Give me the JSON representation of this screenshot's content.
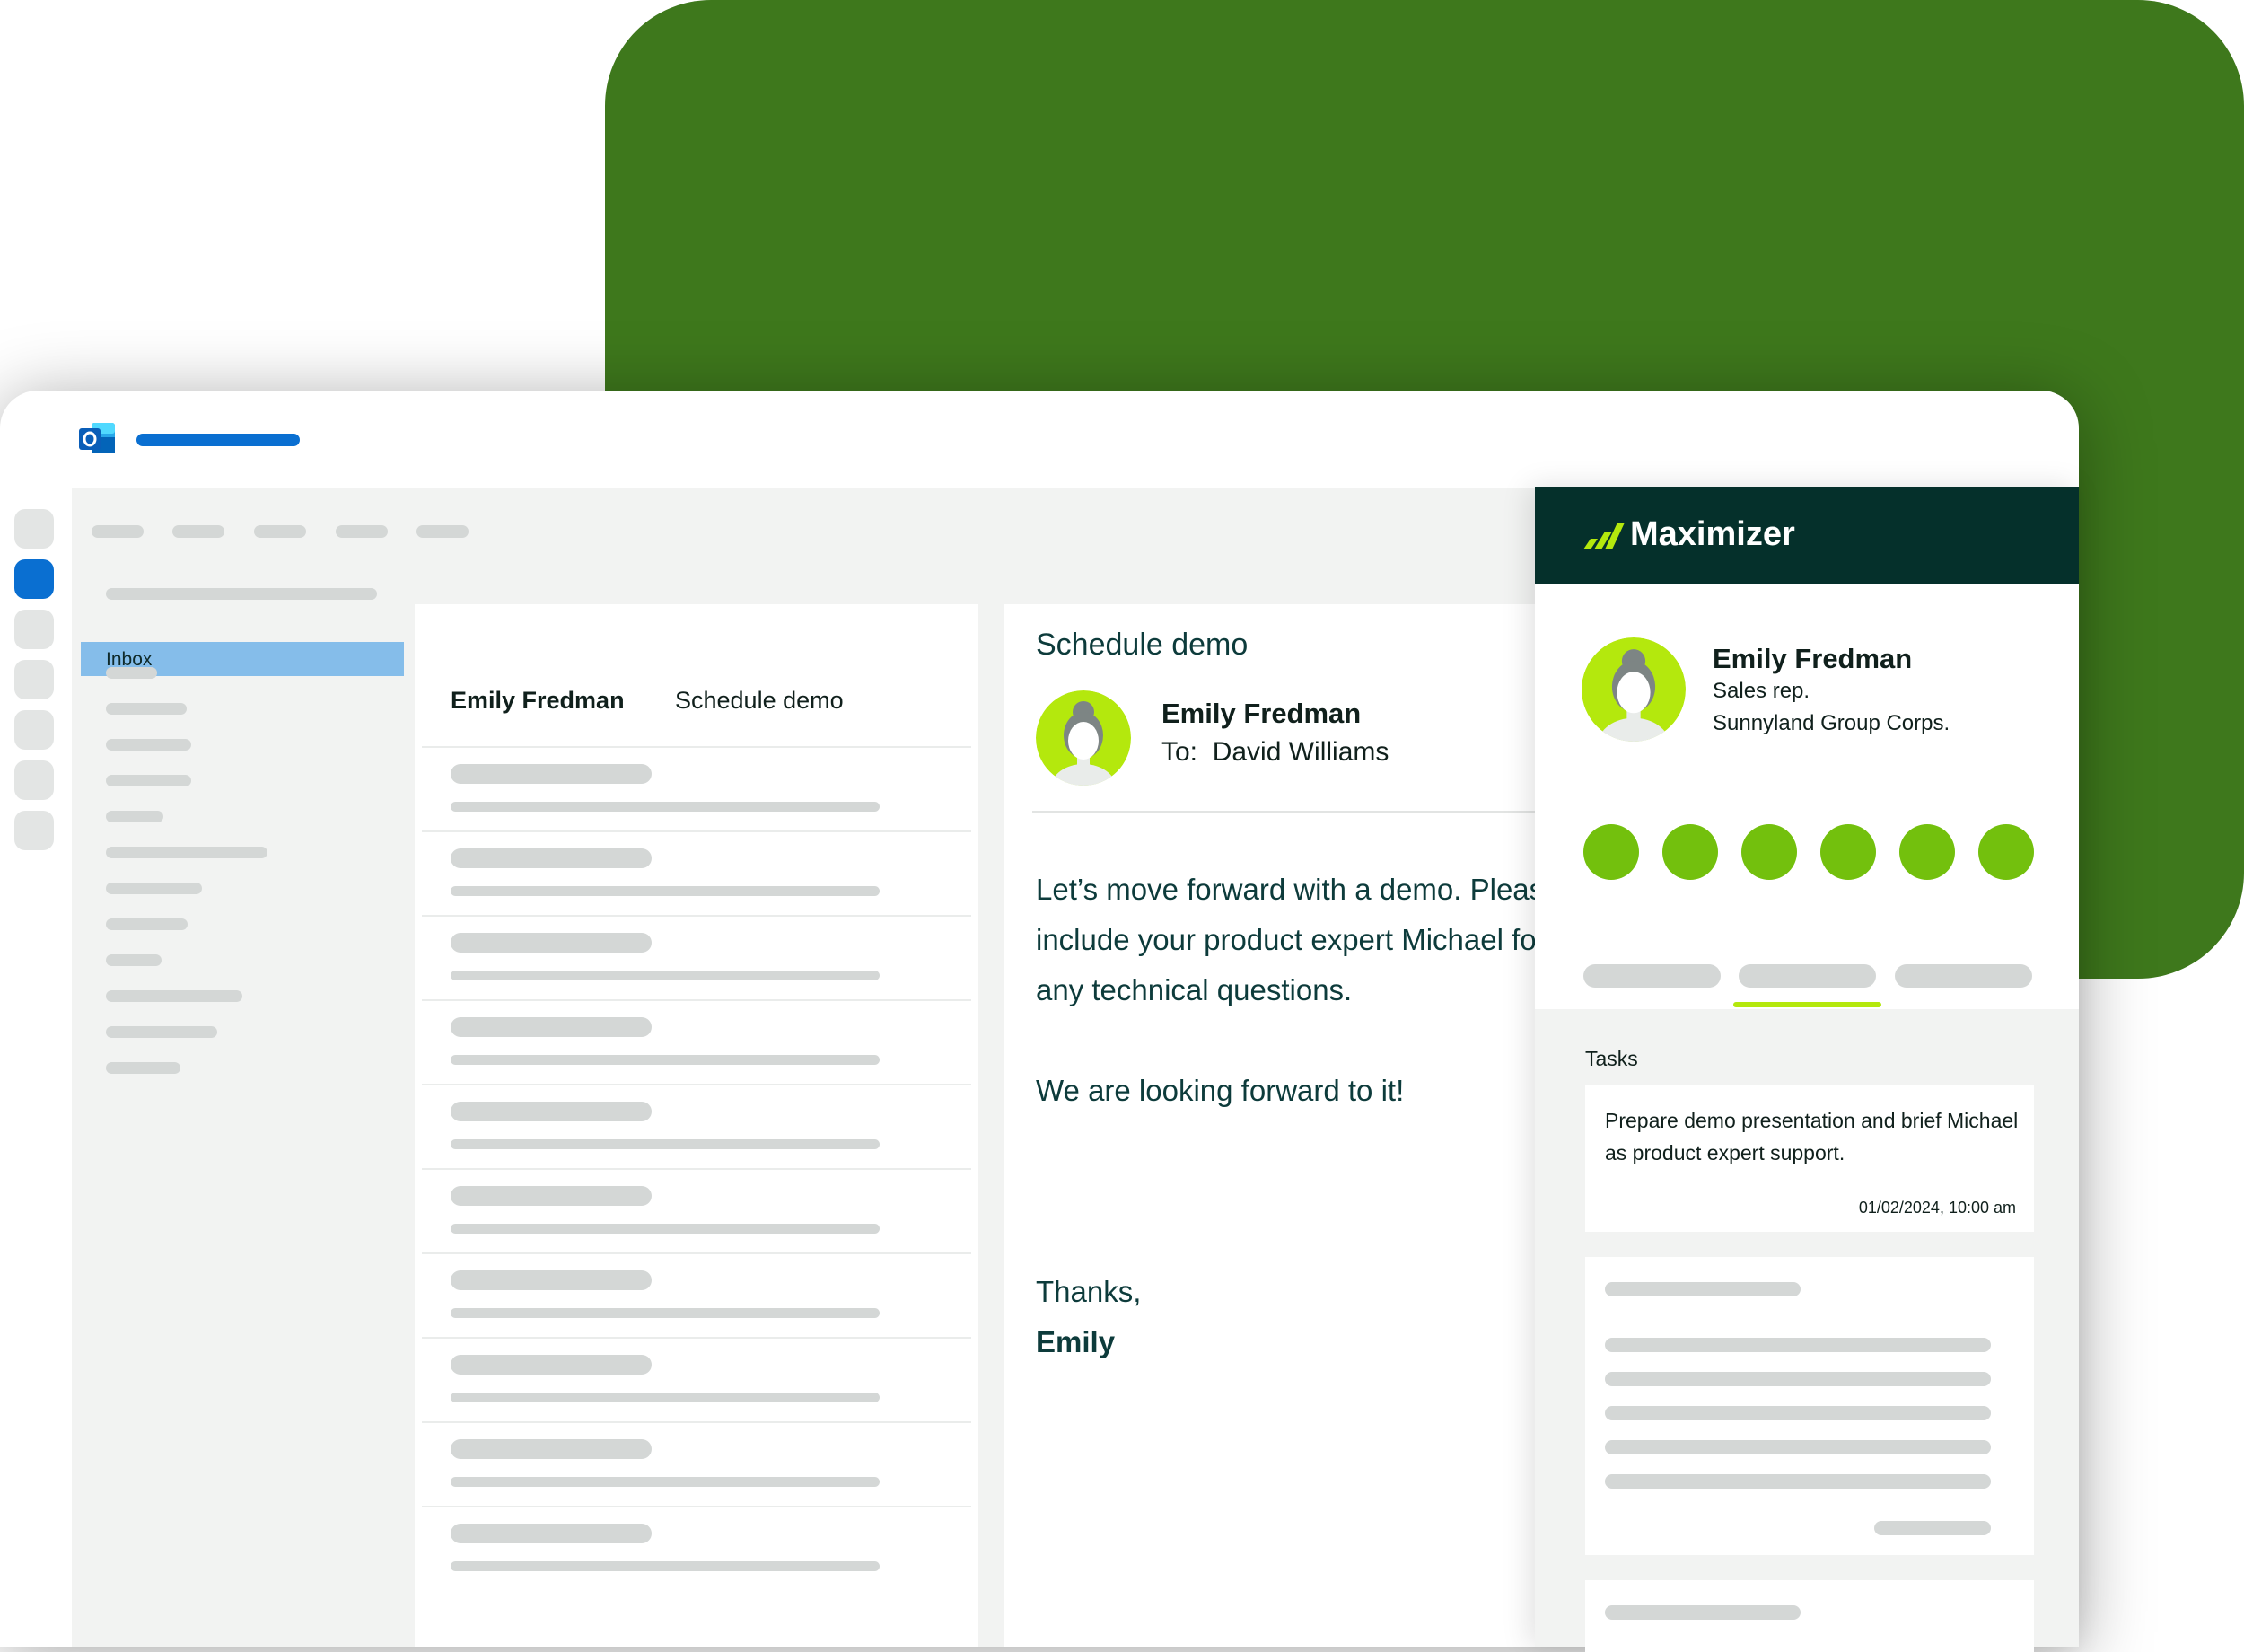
{
  "reading_pane": {
    "subject": "Schedule demo",
    "sender": "Emily Fredman",
    "to_line": "To:  David Williams",
    "body_lines": [
      "Let’s move forward with a demo. Please",
      "include your product expert Michael for",
      "any technical questions."
    ],
    "body_closing": "We are looking forward to it!",
    "sign_off": "Thanks,",
    "signature": "Emily"
  },
  "folder_pane": {
    "inbox_label": "Inbox"
  },
  "message_list": {
    "header_sender": "Emily Fredman",
    "header_subject": "Schedule demo"
  },
  "crm_panel": {
    "brand": "Maximizer",
    "contact": {
      "name": "Emily Fredman",
      "role": "Sales rep.",
      "company": "Sunnyland Group Corps."
    },
    "tasks_label": "Tasks",
    "task": {
      "text": "Prepare demo presentation and brief Michael as product expert support.",
      "date": "01/02/2024, 10:00 am"
    }
  },
  "colors": {
    "background_accent": "#3e781c",
    "outlook_blue": "#0a6fd1",
    "inbox_highlight": "#85bdea",
    "crm_header": "#05302b",
    "action_green": "#73c00d",
    "tab_indicator": "#b4e80d"
  },
  "icons": {
    "app_icon": "outlook-icon",
    "brand_icon": "maximizer-logo-icon",
    "avatar_icon": "person-avatar-icon"
  }
}
